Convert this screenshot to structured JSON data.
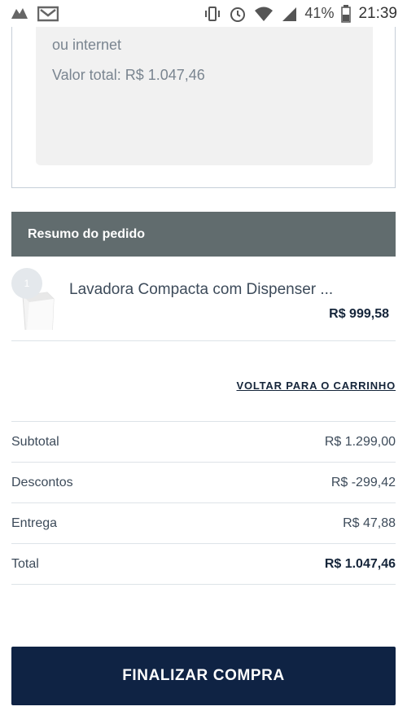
{
  "status_bar": {
    "battery": "41%",
    "time": "21:39",
    "icons": [
      "notification-app-icon",
      "gmail-icon",
      "vibrate-icon",
      "alarm-icon",
      "wifi-icon",
      "signal-icon",
      "battery-icon"
    ]
  },
  "payment": {
    "line1": "ou internet",
    "line2": "Valor total: R$ 1.047,46"
  },
  "summary": {
    "title": "Resumo do pedido",
    "items": [
      {
        "qty": "1",
        "name": "Lavadora Compacta com Dispenser ...",
        "price": "R$ 999,58"
      }
    ],
    "back_link": "VOLTAR PARA O CARRINHO"
  },
  "totals": {
    "subtotal_label": "Subtotal",
    "subtotal_value": "R$ 1.299,00",
    "discount_label": "Descontos",
    "discount_value": "R$ -299,42",
    "shipping_label": "Entrega",
    "shipping_value": "R$ 47,88",
    "total_label": "Total",
    "total_value": "R$ 1.047,46"
  },
  "actions": {
    "finalize_label": "FINALIZAR COMPRA"
  },
  "colors": {
    "header_bg": "#616c6e",
    "button_bg": "#0f2344",
    "text_dark": "#15253a"
  }
}
